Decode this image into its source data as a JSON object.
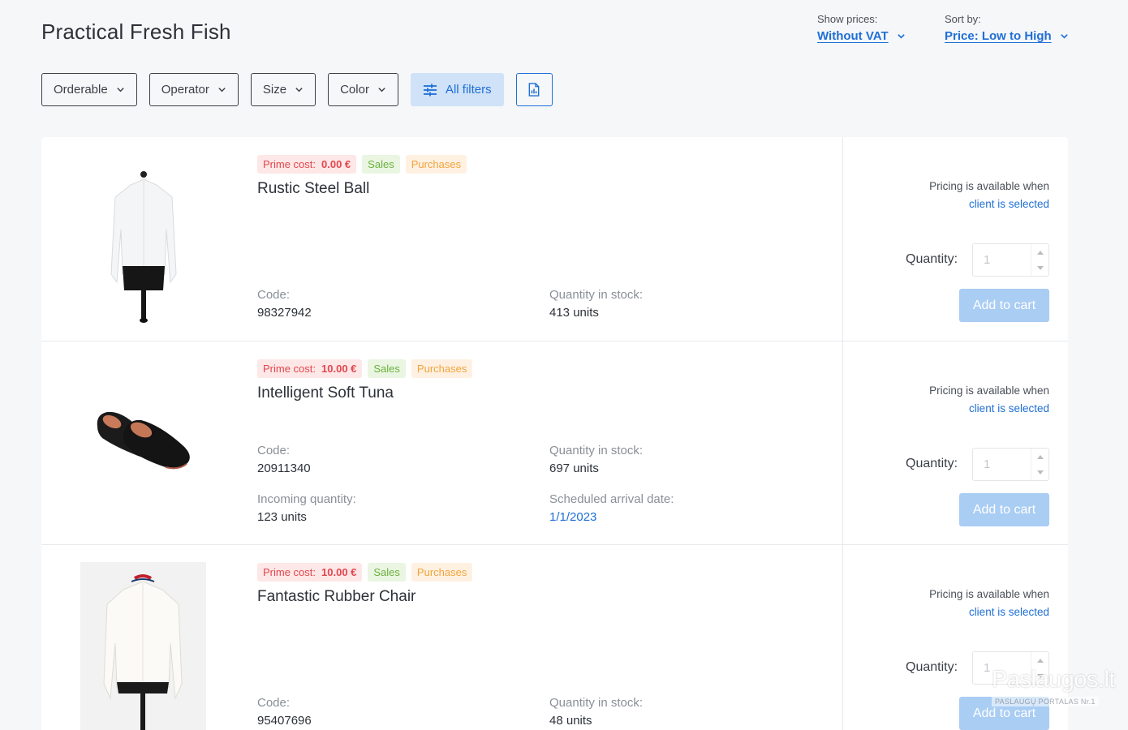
{
  "page": {
    "title": "Practical Fresh Fish"
  },
  "show_prices": {
    "label": "Show prices:",
    "value": "Without VAT"
  },
  "sort_by": {
    "label": "Sort by:",
    "value": "Price: Low to High"
  },
  "filters": [
    {
      "label": "Orderable"
    },
    {
      "label": "Operator"
    },
    {
      "label": "Size"
    },
    {
      "label": "Color"
    }
  ],
  "all_filters_label": "All filters",
  "product_labels": {
    "prime_cost": "Prime cost:",
    "sales": "Sales",
    "purchases": "Purchases",
    "code": "Code:",
    "stock": "Quantity in stock:",
    "incoming": "Incoming quantity:",
    "arrival": "Scheduled arrival date:",
    "pricing_line1": "Pricing is available when",
    "pricing_line2": "client is selected",
    "quantity": "Quantity:",
    "quantity_placeholder": "1",
    "add_to_cart": "Add to cart"
  },
  "products": [
    {
      "name": "Rustic Steel Ball",
      "prime_cost": "0.00 €",
      "code": "98327942",
      "stock": "413 units",
      "image": "white-shirt"
    },
    {
      "name": "Intelligent Soft Tuna",
      "prime_cost": "10.00 €",
      "code": "20911340",
      "stock": "697 units",
      "incoming": "123 units",
      "arrival": "1/1/2023",
      "image": "black-flats"
    },
    {
      "name": "Fantastic Rubber Chair",
      "prime_cost": "10.00 €",
      "code": "95407696",
      "stock": "48 units",
      "image": "white-jacket"
    }
  ],
  "watermark": {
    "brand": "Paslaugos.lt",
    "sub": "PASLAUGŲ PORTALAS Nr.1"
  },
  "colors": {
    "accent": "#1f6fd6",
    "prime": "#e2474d",
    "sales": "#6bb23d",
    "purchases": "#f2a33e",
    "cart_disabled": "#a9cdf3"
  }
}
